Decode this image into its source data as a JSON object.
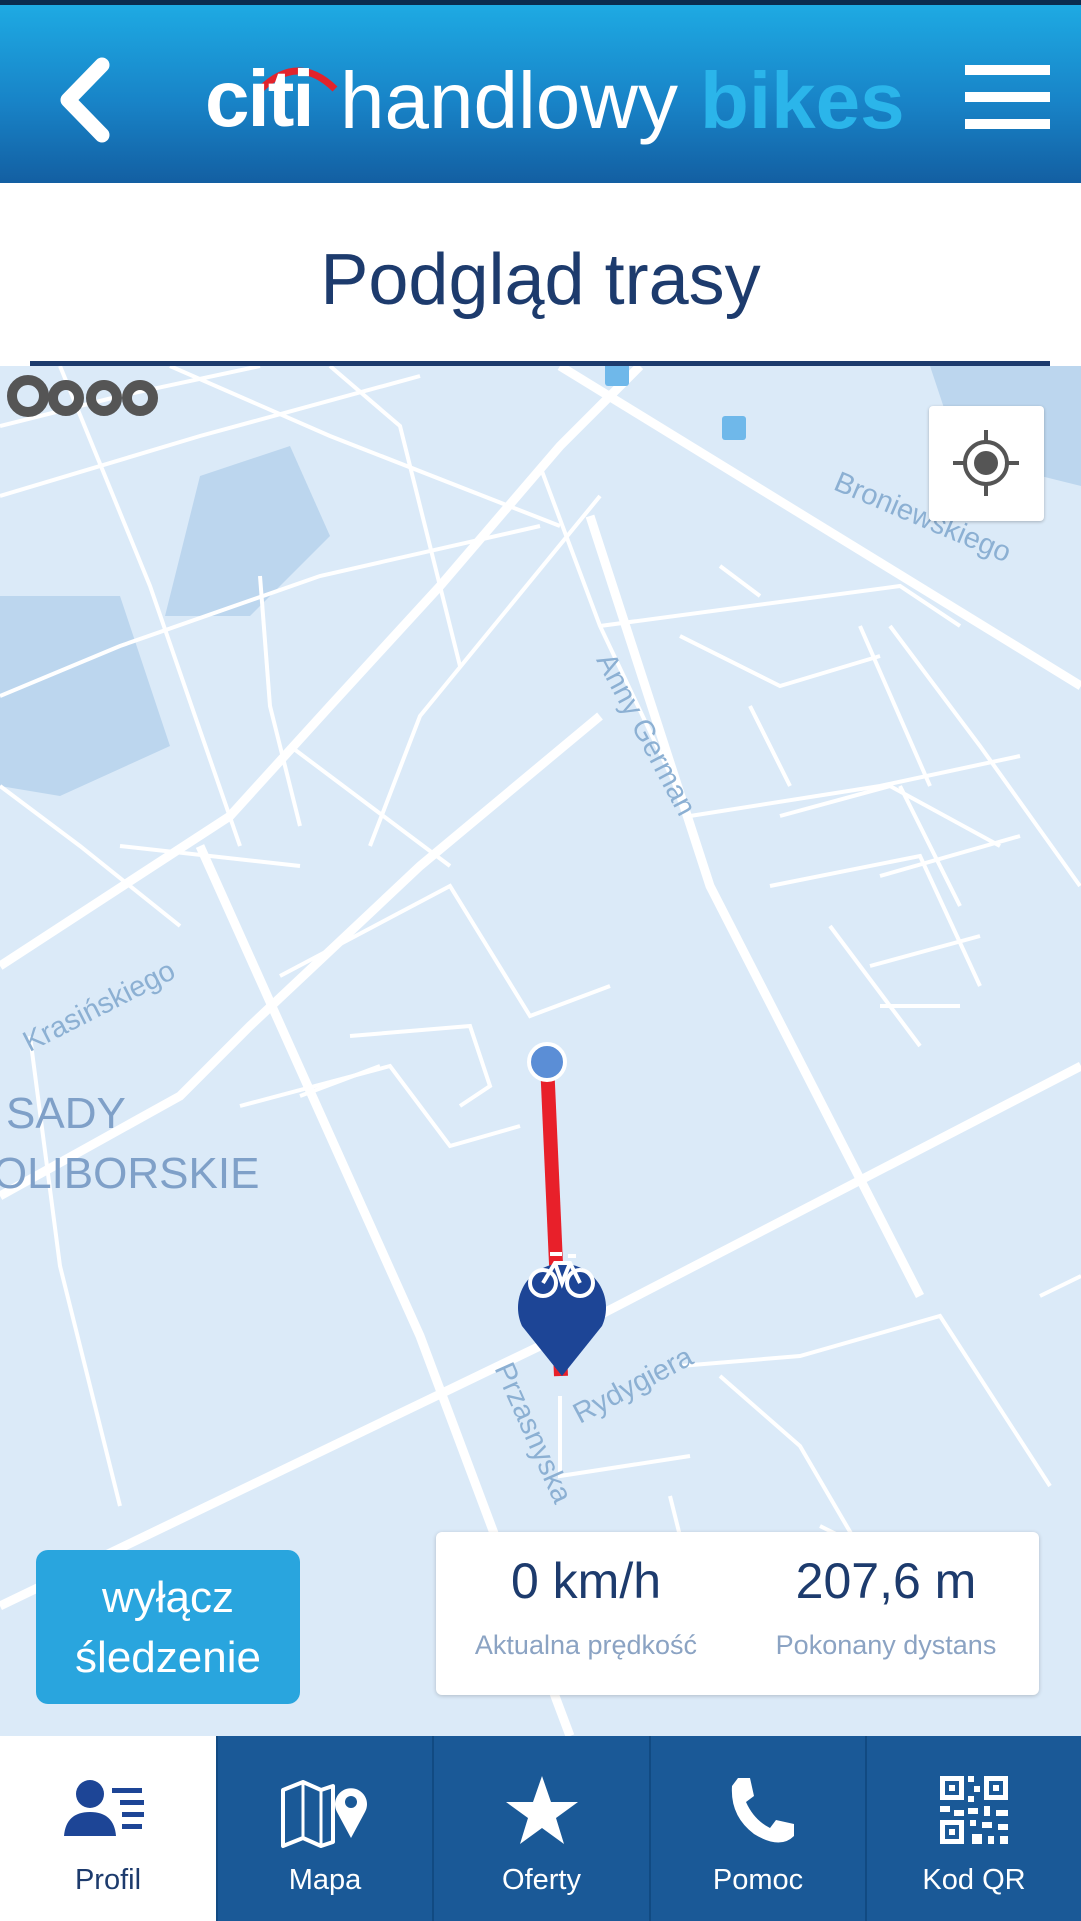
{
  "header": {
    "logo_citi": "citi",
    "logo_handlowy": "handlowy",
    "logo_bikes": "bikes"
  },
  "page_title": "Podgląd trasy",
  "map": {
    "streets": {
      "broniewskiego": "Broniewskiego",
      "anny_german": "Anny German",
      "krasinskiego": "Krasińskiego",
      "rydygiera": "Rydygiera",
      "przasnyska": "Przasnyska"
    },
    "district_line1": "SADY",
    "district_line2": "ŻOLIBORSKIE",
    "route_color": "#e8202a",
    "marker_color": "#1d4596"
  },
  "tracking_button": {
    "line1": "wyłącz",
    "line2": "śledzenie"
  },
  "stats": {
    "speed_value": "0 km/h",
    "speed_label": "Aktualna prędkość",
    "distance_value": "207,6 m",
    "distance_label": "Pokonany dystans"
  },
  "nav": {
    "items": [
      {
        "label": "Profil",
        "icon": "profile-icon",
        "active": true
      },
      {
        "label": "Mapa",
        "icon": "map-icon",
        "active": false
      },
      {
        "label": "Oferty",
        "icon": "star-icon",
        "active": false
      },
      {
        "label": "Pomoc",
        "icon": "phone-icon",
        "active": false
      },
      {
        "label": "Kod QR",
        "icon": "qr-code-icon",
        "active": false
      }
    ]
  }
}
